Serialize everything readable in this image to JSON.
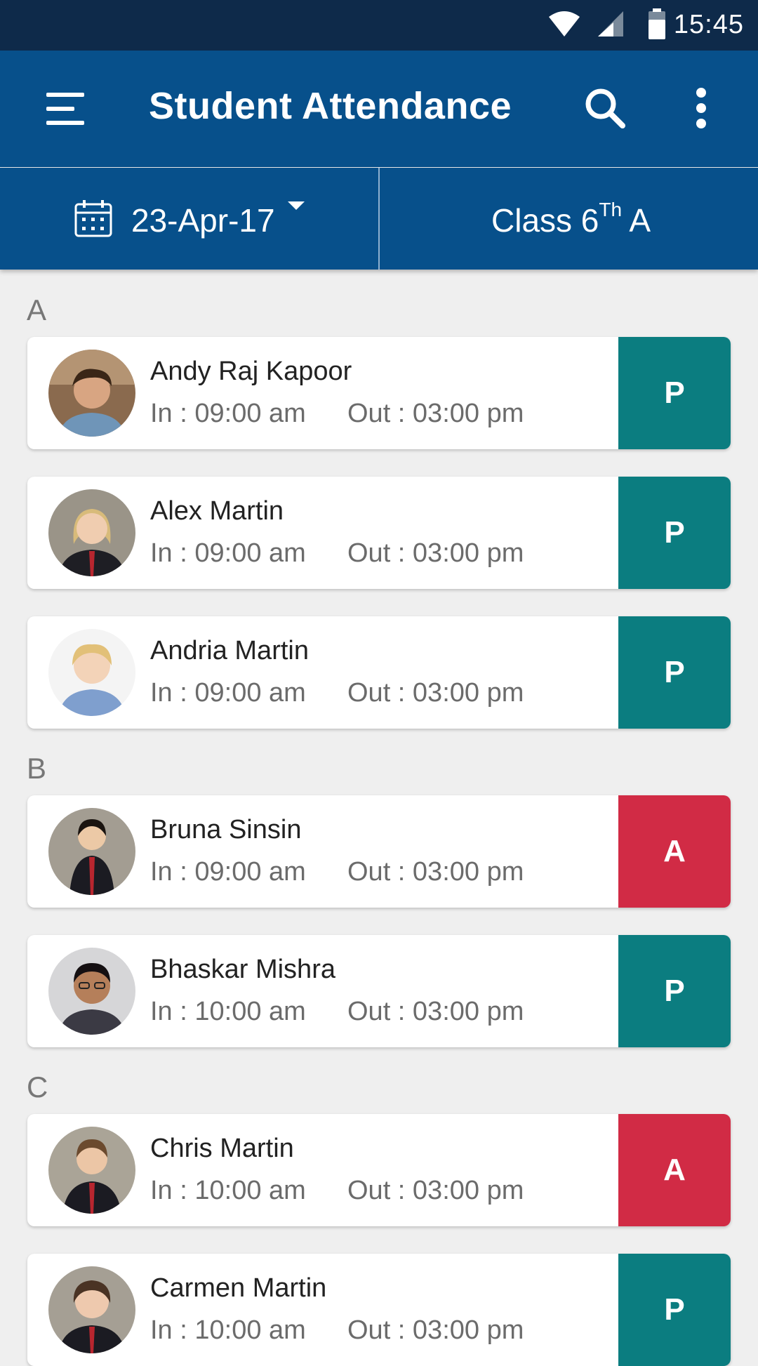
{
  "status_bar": {
    "time": "15:45"
  },
  "app_bar": {
    "title": "Student Attendance"
  },
  "filters": {
    "date": "23-Apr-17",
    "class_prefix": "Class 6",
    "class_sup": "Th",
    "class_suffix": " A"
  },
  "colors": {
    "present": "#0b7d80",
    "absent": "#d12b45",
    "primary": "#07508b"
  },
  "sections": [
    {
      "letter": "A"
    },
    {
      "letter": "B"
    },
    {
      "letter": "C"
    }
  ],
  "students": [
    {
      "name": "Andy Raj Kapoor",
      "in": "In : 09:00 am",
      "out": "Out : 03:00 pm",
      "status": "P"
    },
    {
      "name": "Alex Martin",
      "in": "In : 09:00 am",
      "out": "Out : 03:00 pm",
      "status": "P"
    },
    {
      "name": "Andria Martin",
      "in": "In : 09:00 am",
      "out": "Out : 03:00 pm",
      "status": "P"
    },
    {
      "name": "Bruna Sinsin",
      "in": "In : 09:00 am",
      "out": "Out : 03:00 pm",
      "status": "A"
    },
    {
      "name": "Bhaskar Mishra",
      "in": "In : 10:00 am",
      "out": "Out : 03:00 pm",
      "status": "P"
    },
    {
      "name": "Chris Martin",
      "in": "In : 10:00 am",
      "out": "Out : 03:00 pm",
      "status": "A"
    },
    {
      "name": "Carmen Martin",
      "in": "In : 10:00 am",
      "out": "Out : 03:00 pm",
      "status": "P"
    }
  ]
}
